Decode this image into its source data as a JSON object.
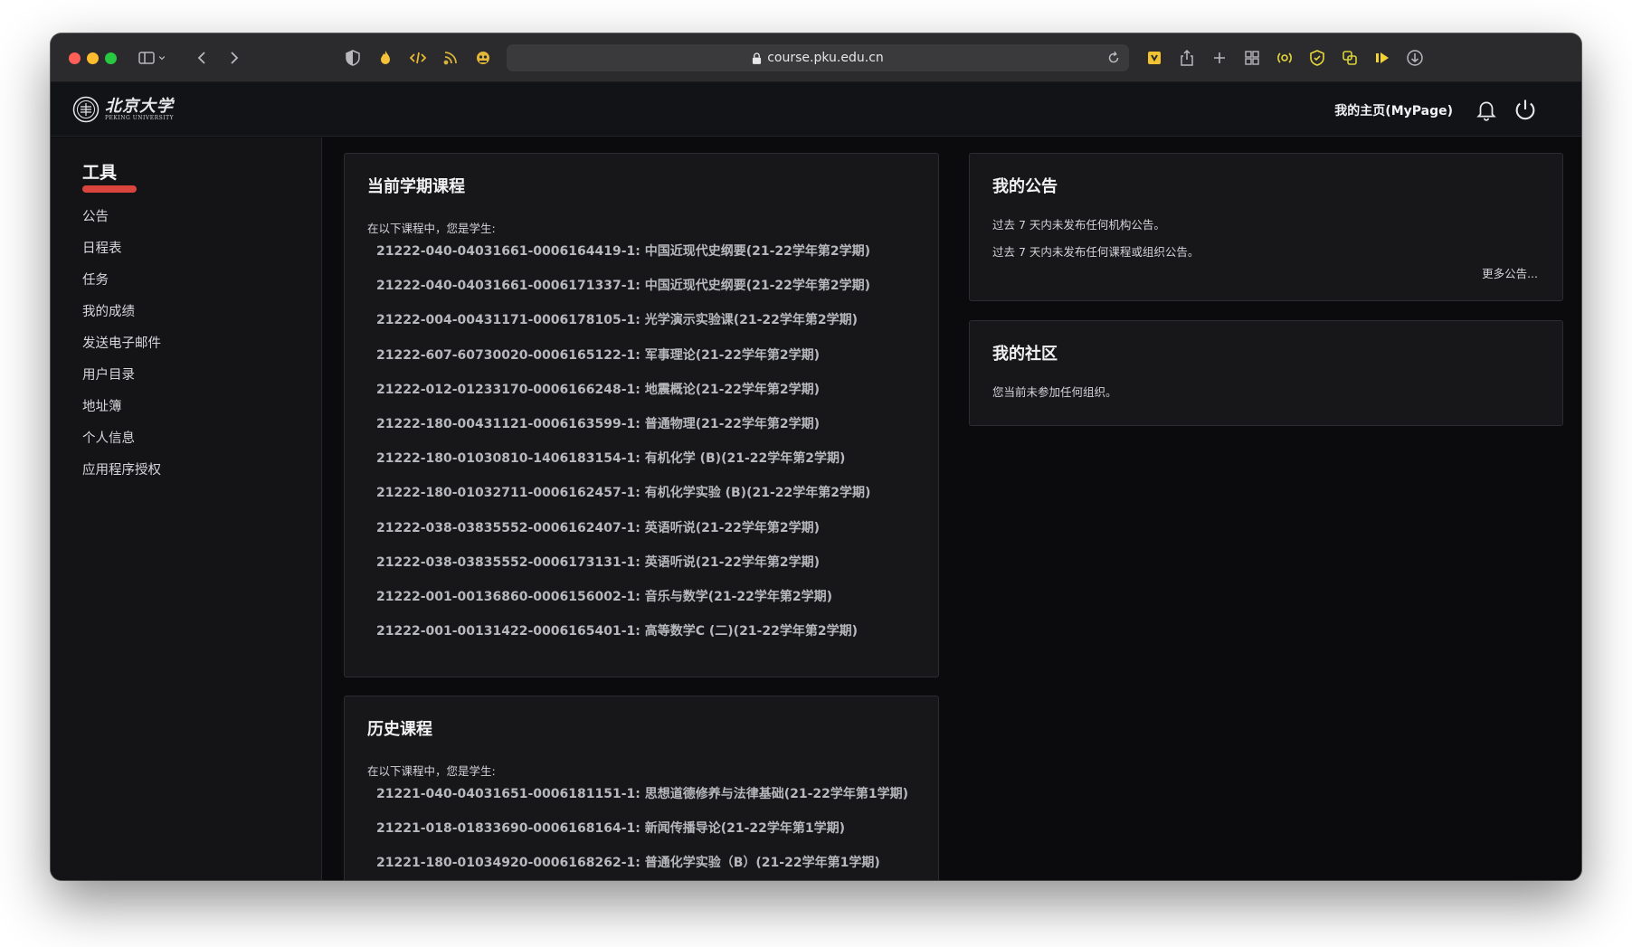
{
  "browser": {
    "url": "course.pku.edu.cn",
    "icons": [
      "sidebar-toggle-icon",
      "chevron-down-icon",
      "back-icon",
      "forward-icon",
      "shield-half-icon",
      "flame-icon",
      "code-icon",
      "rss-icon",
      "ghost-icon",
      "reload-icon",
      "extension-puzzle-icon",
      "share-icon",
      "new-tab-icon",
      "tab-overview-icon",
      "radio-icon",
      "shield-check-icon",
      "translate-icon",
      "play-icon",
      "download-icon"
    ]
  },
  "header": {
    "logo_cn": "北京大学",
    "logo_en": "PEKING UNIVERSITY",
    "mypage_label": "我的主页(MyPage)"
  },
  "sidebar": {
    "title": "工具",
    "items": [
      {
        "label": "公告"
      },
      {
        "label": "日程表"
      },
      {
        "label": "任务"
      },
      {
        "label": "我的成绩"
      },
      {
        "label": "发送电子邮件"
      },
      {
        "label": "用户目录"
      },
      {
        "label": "地址簿"
      },
      {
        "label": "个人信息"
      },
      {
        "label": "应用程序授权"
      }
    ]
  },
  "current_courses": {
    "title": "当前学期课程",
    "intro": "在以下课程中，您是学生:",
    "items": [
      "21222-040-04031661-0006164419-1: 中国近现代史纲要(21-22学年第2学期)",
      "21222-040-04031661-0006171337-1: 中国近现代史纲要(21-22学年第2学期)",
      "21222-004-00431171-0006178105-1: 光学演示实验课(21-22学年第2学期)",
      "21222-607-60730020-0006165122-1: 军事理论(21-22学年第2学期)",
      "21222-012-01233170-0006166248-1: 地震概论(21-22学年第2学期)",
      "21222-180-00431121-0006163599-1: 普通物理(21-22学年第2学期)",
      "21222-180-01030810-1406183154-1: 有机化学 (B)(21-22学年第2学期)",
      "21222-180-01032711-0006162457-1: 有机化学实验 (B)(21-22学年第2学期)",
      "21222-038-03835552-0006162407-1: 英语听说(21-22学年第2学期)",
      "21222-038-03835552-0006173131-1: 英语听说(21-22学年第2学期)",
      "21222-001-00136860-0006156002-1: 音乐与数学(21-22学年第2学期)",
      "21222-001-00131422-0006165401-1: 高等数学C (二)(21-22学年第2学期)"
    ]
  },
  "history_courses": {
    "title": "历史课程",
    "intro": "在以下课程中，您是学生:",
    "items": [
      "21221-040-04031651-0006181151-1: 思想道德修养与法律基础(21-22学年第1学期)",
      "21221-018-01833690-0006168164-1: 新闻传播导论(21-22学年第1学期)",
      "21221-180-01034920-0006168262-1: 普通化学实验（B）(21-22学年第1学期)"
    ]
  },
  "announcements": {
    "title": "我的公告",
    "line1": "过去 7 天内未发布任何机构公告。",
    "line2": "过去 7 天内未发布任何课程或组织公告。",
    "more": "更多公告..."
  },
  "community": {
    "title": "我的社区",
    "text": "您当前未参加任何组织。"
  },
  "colors": {
    "accent_underline": "#d9443d",
    "page_bg": "#0b0b0d",
    "card_bg": "#17171a"
  }
}
